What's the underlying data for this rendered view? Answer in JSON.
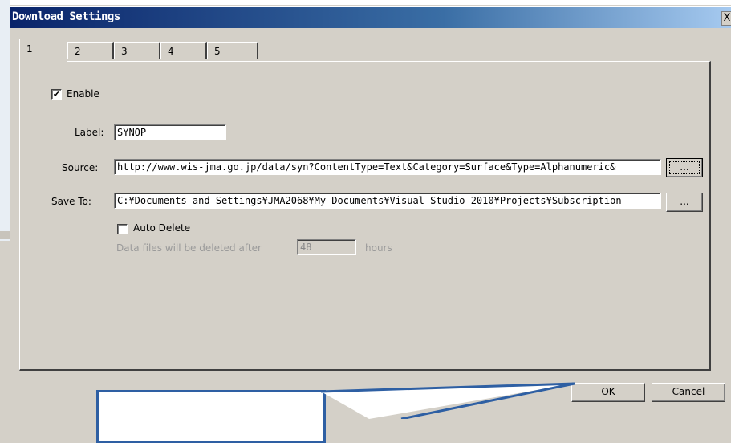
{
  "dialog": {
    "title": "Download Settings",
    "close_glyph": "X"
  },
  "tabs": [
    {
      "label": "1",
      "active": true
    },
    {
      "label": "2",
      "active": false
    },
    {
      "label": "3",
      "active": false
    },
    {
      "label": "4",
      "active": false
    },
    {
      "label": "5",
      "active": false
    }
  ],
  "form": {
    "enable_label": "Enable",
    "enable_checked": "✔",
    "label_label": "Label:",
    "label_value": "SYNOP",
    "source_label": "Source:",
    "source_value": "http://www.wis-jma.go.jp/data/syn?ContentType=Text&Category=Surface&Type=Alphanumeric&",
    "source_browse": "...",
    "saveto_label": "Save To:",
    "saveto_value": "C:¥Documents and Settings¥JMA2068¥My Documents¥Visual Studio 2010¥Projects¥Subscription",
    "saveto_browse": "...",
    "auto_delete_label": "Auto Delete",
    "auto_delete_checked": "",
    "delete_after_label": "Data files will be deleted after",
    "delete_after_value": "48",
    "hours_label": "hours"
  },
  "buttons": {
    "ok": "OK",
    "cancel": "Cancel"
  },
  "colors": {
    "title_start": "#0a246a",
    "title_end": "#a6caf0",
    "callout_border": "#2e5fa3"
  }
}
